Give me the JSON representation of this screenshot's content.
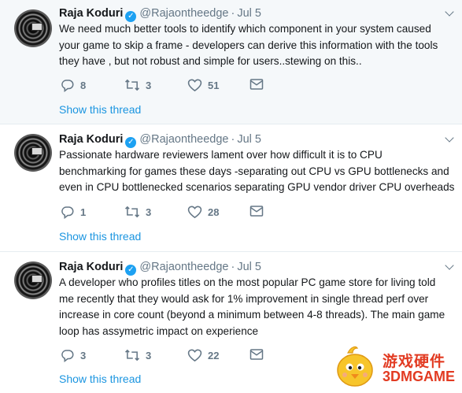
{
  "tweets": [
    {
      "author": "Raja Koduri",
      "handle": "@Rajaontheedge",
      "time": "Jul 5",
      "separator": "·",
      "lines": [
        "We need much better tools to identify which component in your system caused",
        "your game to skip a frame - developers can derive this information with the tools",
        "they have , but not robust and simple for users..stewing on this.."
      ],
      "replies": "8",
      "retweets": "3",
      "likes": "51",
      "show_thread": "Show this thread"
    },
    {
      "author": "Raja Koduri",
      "handle": "@Rajaontheedge",
      "time": "Jul 5",
      "separator": "·",
      "lines": [
        "Passionate hardware reviewers lament over how difficult it is to CPU",
        "benchmarking for games these days -separating out CPU vs GPU bottlenecks and",
        "even in CPU bottlenecked scenarios separating GPU vendor driver CPU overheads"
      ],
      "replies": "1",
      "retweets": "3",
      "likes": "28",
      "show_thread": "Show this thread"
    },
    {
      "author": "Raja Koduri",
      "handle": "@Rajaontheedge",
      "time": "Jul 5",
      "separator": "·",
      "lines": [
        "A developer who profiles titles on the most popular PC game store for living told",
        "me recently that they would ask for 1% improvement in single thread perf over",
        "increase in core count (beyond a minimum between 4-8 threads). The main game",
        "loop has assymetric impact on experience"
      ],
      "replies": "3",
      "retweets": "3",
      "likes": "22",
      "show_thread": "Show this thread"
    }
  ],
  "watermark": {
    "cn_text": "游戏硬件",
    "en_text": "3DMGAME"
  },
  "colors": {
    "accent": "#1b95e0",
    "muted": "#657786",
    "verified": "#1da1f2",
    "first_bg": "#f5f8fa"
  },
  "icons": [
    "reply-icon",
    "retweet-icon",
    "like-icon",
    "message-icon",
    "verified-icon",
    "chevron-down-icon"
  ]
}
